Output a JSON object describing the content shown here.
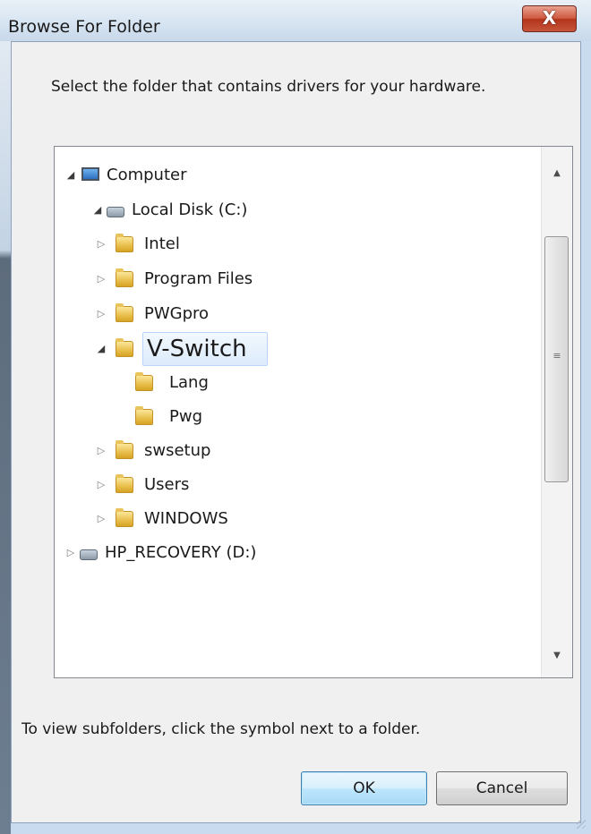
{
  "window": {
    "title": "Browse For Folder",
    "close_glyph": "X"
  },
  "instruction": "Select the folder that contains drivers for your hardware.",
  "tree": {
    "items": [
      {
        "label": "Computer",
        "icon": "computer-icon",
        "expanded": true
      },
      {
        "label": "Local Disk (C:)",
        "icon": "local-disk-icon",
        "expanded": true
      },
      {
        "label": "Intel",
        "icon": "folder-icon",
        "expanded": false
      },
      {
        "label": "Program Files",
        "icon": "folder-icon",
        "expanded": false
      },
      {
        "label": "PWGpro",
        "icon": "folder-icon",
        "expanded": false
      },
      {
        "label": "V-Switch",
        "icon": "folder-icon",
        "expanded": true,
        "selected": true
      },
      {
        "label": "Lang",
        "icon": "folder-icon"
      },
      {
        "label": "Pwg",
        "icon": "folder-icon"
      },
      {
        "label": "swsetup",
        "icon": "folder-icon",
        "expanded": false
      },
      {
        "label": "Users",
        "icon": "folder-icon",
        "expanded": false
      },
      {
        "label": "WINDOWS",
        "icon": "folder-icon",
        "expanded": false
      },
      {
        "label": "HP_RECOVERY (D:)",
        "icon": "drive-icon",
        "expanded": false
      }
    ],
    "scrollbar": {
      "up_glyph": "▲",
      "down_glyph": "▼",
      "grip_glyph": "≡"
    }
  },
  "hint": "To view subfolders, click the symbol next to a folder.",
  "buttons": {
    "ok": "OK",
    "cancel": "Cancel"
  },
  "colors": {
    "selection_border": "#b8d6fb",
    "close_button": "#c6553b",
    "default_button_border": "#3c7fb1"
  }
}
